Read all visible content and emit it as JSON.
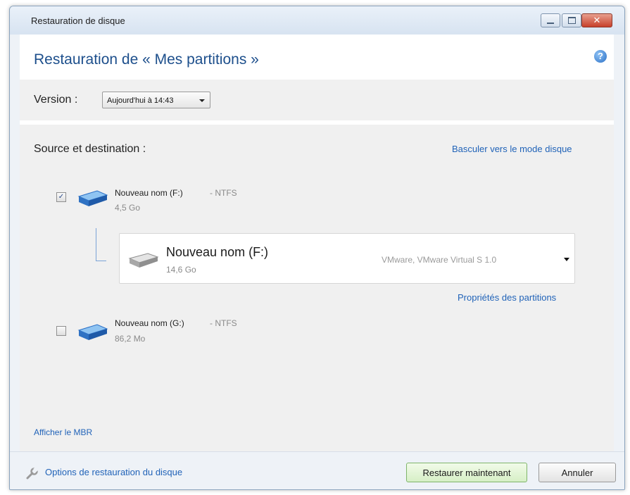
{
  "window": {
    "title": "Restauration de disque"
  },
  "header": {
    "title": "Restauration de « Mes partitions  »"
  },
  "version": {
    "label": "Version :",
    "selected": "Aujourd'hui à 14:43"
  },
  "section": {
    "title": "Source et destination :",
    "switch_link": "Basculer vers le mode disque",
    "mbr_link": "Afficher le MBR",
    "properties_link": "Propriétés des partitions"
  },
  "partitions": [
    {
      "name": "Nouveau nom (F:)",
      "fs": "- NTFS",
      "size": "4,5 Go",
      "checked": true
    },
    {
      "name": "Nouveau nom (G:)",
      "fs": "- NTFS",
      "size": "86,2 Mo",
      "checked": false
    }
  ],
  "destination": {
    "name": "Nouveau nom (F:)",
    "size": "14,6 Go",
    "model": "VMware, VMware Virtual S 1.0"
  },
  "footer": {
    "options_link": "Options de restauration du disque",
    "restore_label": "Restaurer maintenant",
    "cancel_label": "Annuler"
  },
  "colors": {
    "accent": "#2163b8",
    "heading": "#1d4f8c",
    "primary_btn": "#d6efc6"
  },
  "icons": {
    "help": "help-icon",
    "disk": "disk-icon",
    "wrench": "wrench-icon",
    "checkbox_checked_glyph": "✓",
    "help_glyph": "?",
    "close_glyph": "✕"
  }
}
